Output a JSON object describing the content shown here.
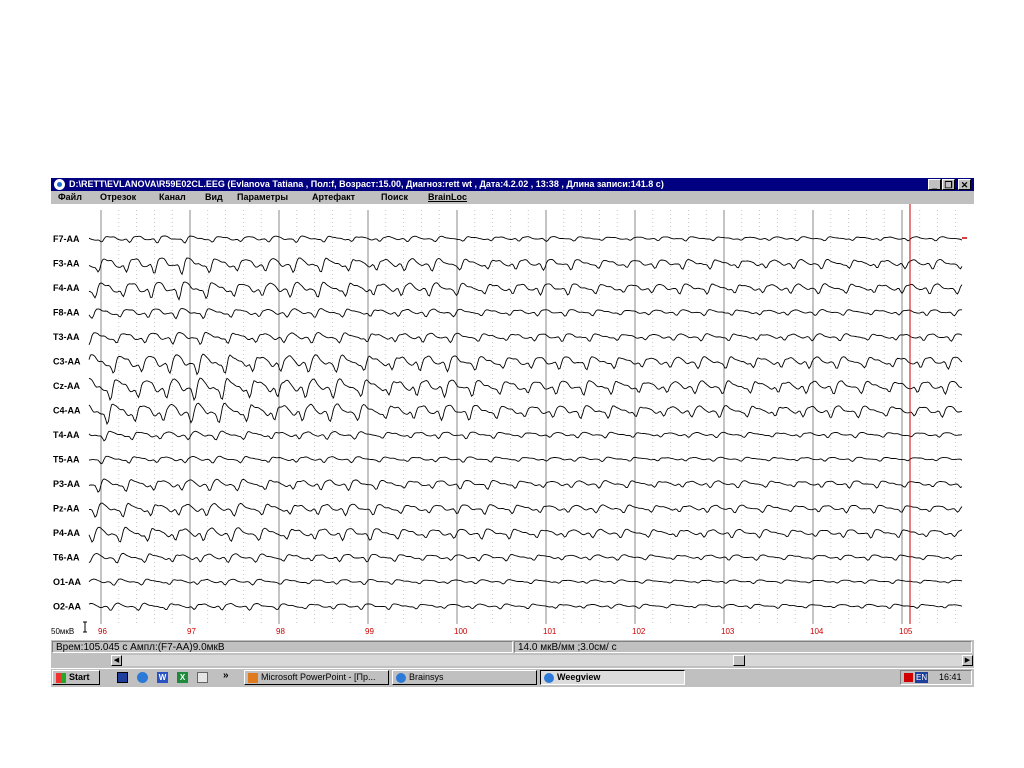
{
  "window": {
    "title": "D:\\RETT\\EVLANOVA\\R59E02CL.EEG (Evlanova Tatiana , Пол:f, Возраст:15.00, Диагноз:rett wt , Дата:4.2.02 , 13:38 , Длина записи:141.8 c)",
    "minimize": "_",
    "restore": "❐",
    "close": "✕"
  },
  "menu": [
    "Файл",
    "Отрезок",
    "Канал",
    "Вид",
    "Параметры",
    "Артефакт",
    "Поиск",
    "BrainLoc"
  ],
  "channels": [
    "F7-AA",
    "F3-AA",
    "F4-AA",
    "F8-AA",
    "T3-AA",
    "C3-AA",
    "Cz-AA",
    "C4-AA",
    "T4-AA",
    "T5-AA",
    "P3-AA",
    "Pz-AA",
    "P4-AA",
    "T6-AA",
    "O1-AA",
    "O2-AA"
  ],
  "time_labels": [
    "96",
    "97",
    "98",
    "99",
    "100",
    "101",
    "102",
    "103",
    "104",
    "105"
  ],
  "scale_label": "50мкВ",
  "status": {
    "position": "Врем:105.045 с Ампл:(F7-AA)9.0мкВ",
    "scale": "14.0 мкВ/мм ;3.0см/ с"
  },
  "taskbar": {
    "start": "Start",
    "chevron": "»",
    "tasks": [
      "Microsoft PowerPoint - [Пр...",
      "Brainsys",
      "Weegview"
    ],
    "lang": "EN",
    "clock": "16:41"
  },
  "colors": {
    "titlebar": "#000080",
    "trace": "#000000",
    "time_label": "#cc0000",
    "cursor": "#cc0000"
  }
}
